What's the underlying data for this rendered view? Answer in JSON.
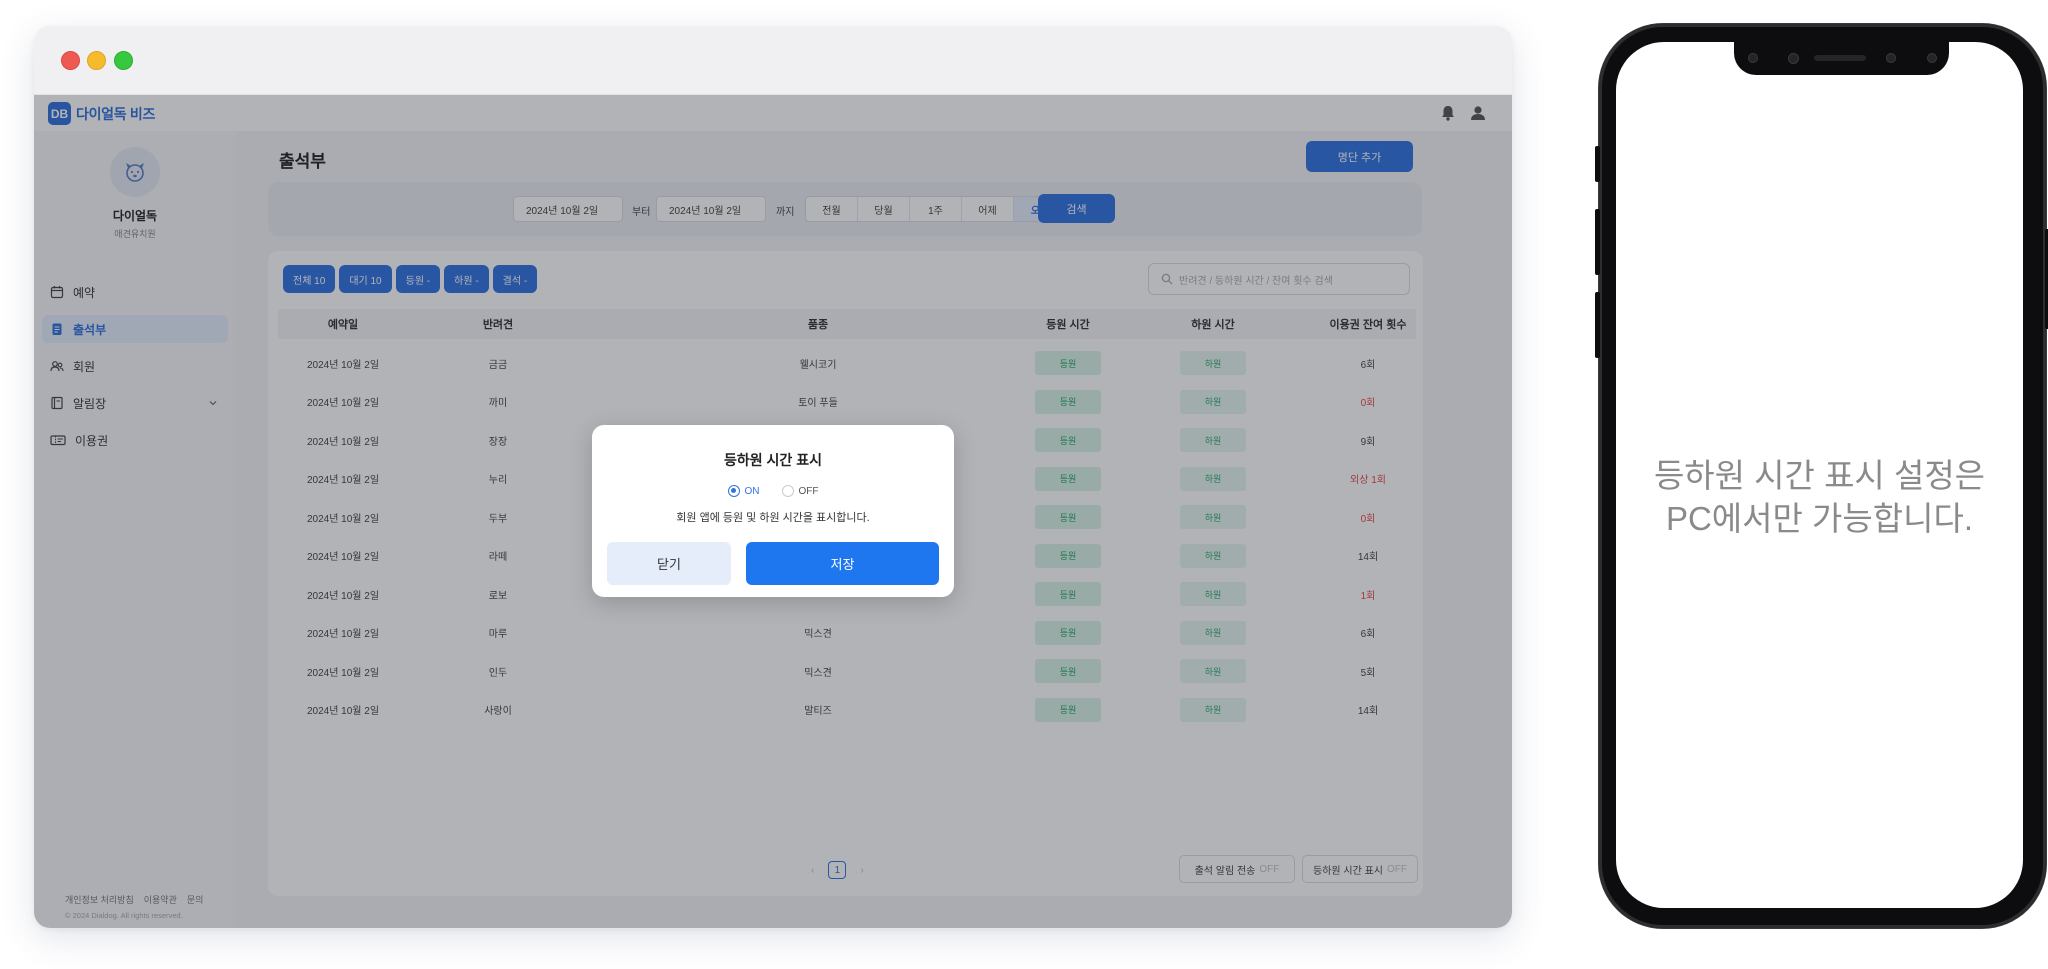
{
  "app": {
    "logo_mark": "DB",
    "logo_text": "다이얼독 비즈",
    "page_title": "출석부",
    "add_button": "명단 추가"
  },
  "profile": {
    "name": "다이얼독",
    "subtitle": "애견유치원"
  },
  "sidebar": {
    "items": [
      {
        "label": "예약",
        "icon": "calendar-icon"
      },
      {
        "label": "출석부",
        "icon": "clipboard-icon",
        "active": true
      },
      {
        "label": "회원",
        "icon": "users-icon"
      },
      {
        "label": "알림장",
        "icon": "notebook-icon"
      },
      {
        "label": "이용권",
        "icon": "ticket-icon"
      }
    ],
    "footer_links": [
      "개인정보 처리방침",
      "이용약관",
      "문의"
    ],
    "copyright": "© 2024 Dialdog. All rights reserved."
  },
  "search": {
    "start_date": "2024년 10월 2일",
    "from_label": "부터",
    "end_date": "2024년 10월 2일",
    "to_label": "까지",
    "periods": [
      "전월",
      "당월",
      "1주",
      "어제",
      "오늘"
    ],
    "active_period": "오늘",
    "search_button": "검색"
  },
  "filters": [
    "전체 10",
    "대기 10",
    "등원 -",
    "하원 -",
    "결석 -"
  ],
  "table_search_placeholder": "반려견 / 등하원 시간 / 잔여 횟수 검색",
  "table": {
    "headers": [
      "예약일",
      "반려견",
      "품종",
      "등원 시간",
      "하원 시간",
      "이용권 잔여 횟수"
    ],
    "checkin_label": "등원",
    "checkout_label": "하원",
    "rows": [
      {
        "date": "2024년 10월 2일",
        "dog": "금금",
        "breed": "웰시코기",
        "remain": "6회",
        "negative": false
      },
      {
        "date": "2024년 10월 2일",
        "dog": "까미",
        "breed": "토이 푸들",
        "remain": "0회",
        "negative": true
      },
      {
        "date": "2024년 10월 2일",
        "dog": "장장",
        "breed": "",
        "remain": "9회",
        "negative": false
      },
      {
        "date": "2024년 10월 2일",
        "dog": "누리",
        "breed": "",
        "remain": "외상 1회",
        "negative": true
      },
      {
        "date": "2024년 10월 2일",
        "dog": "두부",
        "breed": "",
        "remain": "0회",
        "negative": true
      },
      {
        "date": "2024년 10월 2일",
        "dog": "라떼",
        "breed": "",
        "remain": "14회",
        "negative": false
      },
      {
        "date": "2024년 10월 2일",
        "dog": "로보",
        "breed": "",
        "remain": "1회",
        "negative": true
      },
      {
        "date": "2024년 10월 2일",
        "dog": "마루",
        "breed": "믹스견",
        "remain": "6회",
        "negative": false
      },
      {
        "date": "2024년 10월 2일",
        "dog": "인두",
        "breed": "믹스견",
        "remain": "5회",
        "negative": false
      },
      {
        "date": "2024년 10월 2일",
        "dog": "사랑이",
        "breed": "말티즈",
        "remain": "14회",
        "negative": false
      }
    ]
  },
  "pagination": {
    "prev": "‹",
    "current": "1",
    "next": "›"
  },
  "bottom_buttons": {
    "attendance_alert": "출석 알림 전송",
    "attendance_alert_state": "OFF",
    "time_display": "등하원 시간 표시",
    "time_display_state": "OFF"
  },
  "modal": {
    "title": "등하원 시간 표시",
    "on_label": "ON",
    "off_label": "OFF",
    "selected": "ON",
    "description": "회원 앱에 등원 및 하원 시간을 표시합니다.",
    "close_button": "닫기",
    "save_button": "저장"
  },
  "phone": {
    "message": "등하원 시간 표시 설정은\nPC에서만 가능합니다."
  },
  "colors": {
    "primary": "#2f73df",
    "save": "#1f77ef",
    "negative": "#e34a4a",
    "badge_green": "#1fa463"
  }
}
